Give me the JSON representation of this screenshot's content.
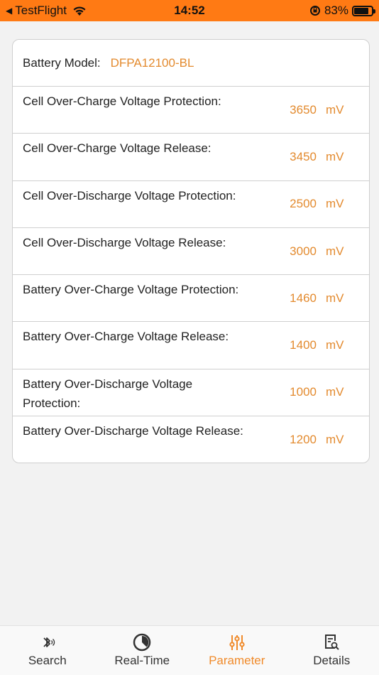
{
  "status_bar": {
    "back_app": "TestFlight",
    "time": "14:52",
    "battery_percent": "83%",
    "battery_level": 0.83
  },
  "card": {
    "model_label": "Battery Model:",
    "model_value": "DFPA12100-BL",
    "rows": [
      {
        "label": "Cell Over-Charge Voltage Protection:",
        "value": "3650",
        "unit": "mV"
      },
      {
        "label": "Cell Over-Charge Voltage Release:",
        "value": "3450",
        "unit": "mV"
      },
      {
        "label": "Cell Over-Discharge Voltage Protection:",
        "value": "2500",
        "unit": "mV"
      },
      {
        "label": "Cell Over-Discharge Voltage Release:",
        "value": "3000",
        "unit": "mV"
      },
      {
        "label": "Battery Over-Charge Voltage Protection:",
        "value": "1460",
        "unit": "mV"
      },
      {
        "label": "Battery Over-Charge Voltage Release:",
        "value": "1400",
        "unit": "mV"
      },
      {
        "label": "Battery Over-Discharge Voltage Protection:",
        "value": "1000",
        "unit": "mV"
      },
      {
        "label": "Battery Over-Discharge Voltage Release:",
        "value": "1200",
        "unit": "mV"
      }
    ]
  },
  "tabbar": {
    "tabs": [
      {
        "label": "Search",
        "icon": "bluetooth-icon"
      },
      {
        "label": "Real-Time",
        "icon": "gauge-icon"
      },
      {
        "label": "Parameter",
        "icon": "sliders-icon"
      },
      {
        "label": "Details",
        "icon": "document-search-icon"
      }
    ],
    "active_index": 2
  },
  "colors": {
    "status_bar": "#ff7a14",
    "accent": "#e38a2e",
    "tab_active": "#f08a2a"
  }
}
